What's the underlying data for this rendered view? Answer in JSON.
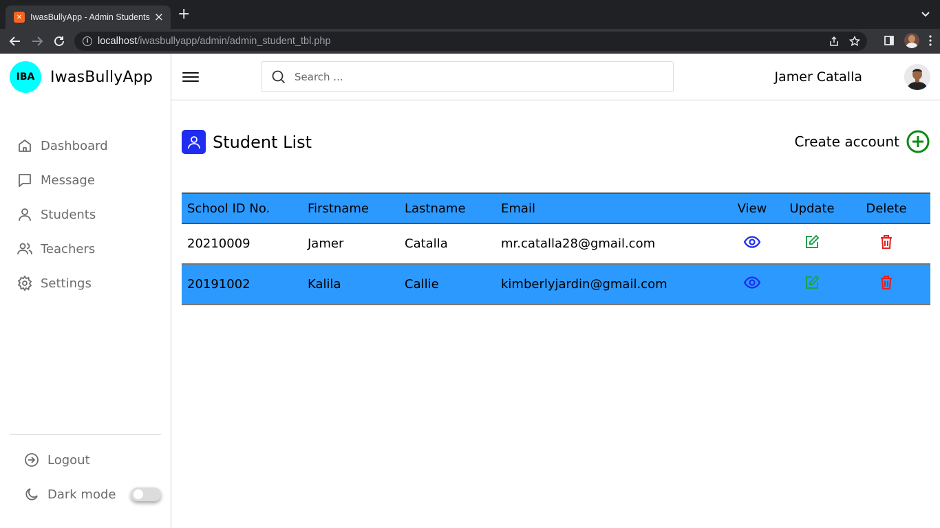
{
  "browser": {
    "tab_title": "IwasBullyApp - Admin Students",
    "tab_favicon": "xampp-icon",
    "url_host": "localhost",
    "url_path": "/iwasbullyapp/admin/admin_student_tbl.php"
  },
  "brand": {
    "logo_text": "IBA",
    "name": "IwasBullyApp",
    "logo_color": "#00ffff"
  },
  "sidebar": {
    "items": [
      {
        "label": "Dashboard",
        "icon": "home-icon"
      },
      {
        "label": "Message",
        "icon": "message-icon"
      },
      {
        "label": "Students",
        "icon": "user-icon"
      },
      {
        "label": "Teachers",
        "icon": "users-icon"
      },
      {
        "label": "Settings",
        "icon": "gear-icon"
      }
    ],
    "logout_label": "Logout",
    "dark_mode_label": "Dark mode",
    "dark_mode_on": false
  },
  "header": {
    "search_placeholder": "Search ...",
    "user_name": "Jamer Catalla"
  },
  "page": {
    "title": "Student List",
    "create_label": "Create account"
  },
  "table": {
    "headers": [
      "School ID No.",
      "Firstname",
      "Lastname",
      "Email",
      "View",
      "Update",
      "Delete"
    ],
    "rows": [
      {
        "id": "20210009",
        "first": "Jamer",
        "last": "Catalla",
        "email": "mr.catalla28@gmail.com"
      },
      {
        "id": "20191002",
        "first": "Kalila",
        "last": "Callie",
        "email": "kimberlyjardin@gmail.com"
      }
    ]
  },
  "colors": {
    "accent_blue": "#2c99ff",
    "view": "#1e2df0",
    "update": "#1aa34a",
    "delete": "#e02020",
    "create": "#0a8a12"
  }
}
